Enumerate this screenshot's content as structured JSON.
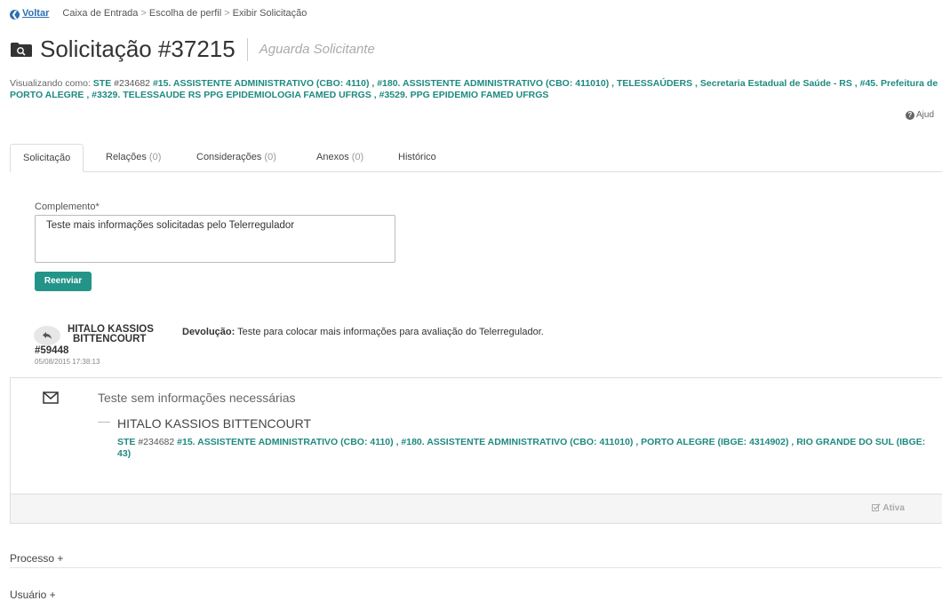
{
  "breadcrumb": {
    "back_label": "Voltar",
    "items": [
      "Caixa de Entrada",
      "Escolha de perfil",
      "Exibir Solicitação"
    ],
    "separator": ">"
  },
  "header": {
    "title": "Solicitação #37215",
    "status": "Aguarda Solicitante",
    "icon": "folder-search-icon"
  },
  "viewing_as": {
    "prefix": "Visualizando como:",
    "ste": "STE",
    "id": "#234682",
    "roles": "#15. ASSISTENTE ADMINISTRATIVO (CBO: 4110) , #180. ASSISTENTE ADMINISTRATIVO (CBO: 411010) , TELESSAÚDERS , Secretaria Estadual de Saúde - RS , #45. Prefeitura de PORTO ALEGRE , #3329. TELESSAUDE RS PPG EPIDEMIOLOGIA FAMED UFRGS , #3529. PPG EPIDEMIO FAMED UFRGS"
  },
  "help_label": "Ajud",
  "tabs": [
    {
      "label": "Solicitação",
      "count": ""
    },
    {
      "label": "Relações",
      "count": "(0)"
    },
    {
      "label": "Considerações",
      "count": "(0)"
    },
    {
      "label": "Anexos",
      "count": "(0)"
    },
    {
      "label": "Histórico",
      "count": ""
    }
  ],
  "form": {
    "complemento_label": "Complemento*",
    "complemento_value": "Teste mais informações solicitadas pelo Telerregulador",
    "resend_label": "Reenviar"
  },
  "entry": {
    "author_line1": "HITALO KASSIOS",
    "author_line2": "BITTENCOURT",
    "author_id": "#59448",
    "date": "05/08/2015 17:38:13",
    "type_label": "Devolução:",
    "text": "Teste para colocar mais informações para avaliação do Telerregulador."
  },
  "message": {
    "text": "Teste sem informações necessárias",
    "author": "HITALO KASSIOS BITTENCOURT",
    "ste": "STE",
    "id": "#234682",
    "roles": "#15. ASSISTENTE ADMINISTRATIVO (CBO: 4110) , #180. ASSISTENTE ADMINISTRATIVO (CBO: 411010) , PORTO ALEGRE (IBGE: 4314902) , RIO GRANDE DO SUL (IBGE: 43)",
    "status_label": "Ativa"
  },
  "sections": [
    "Processo +",
    "Usuário +"
  ],
  "colors": {
    "accent": "#1e8a80",
    "button": "#239488",
    "link": "#2c6fb3"
  }
}
